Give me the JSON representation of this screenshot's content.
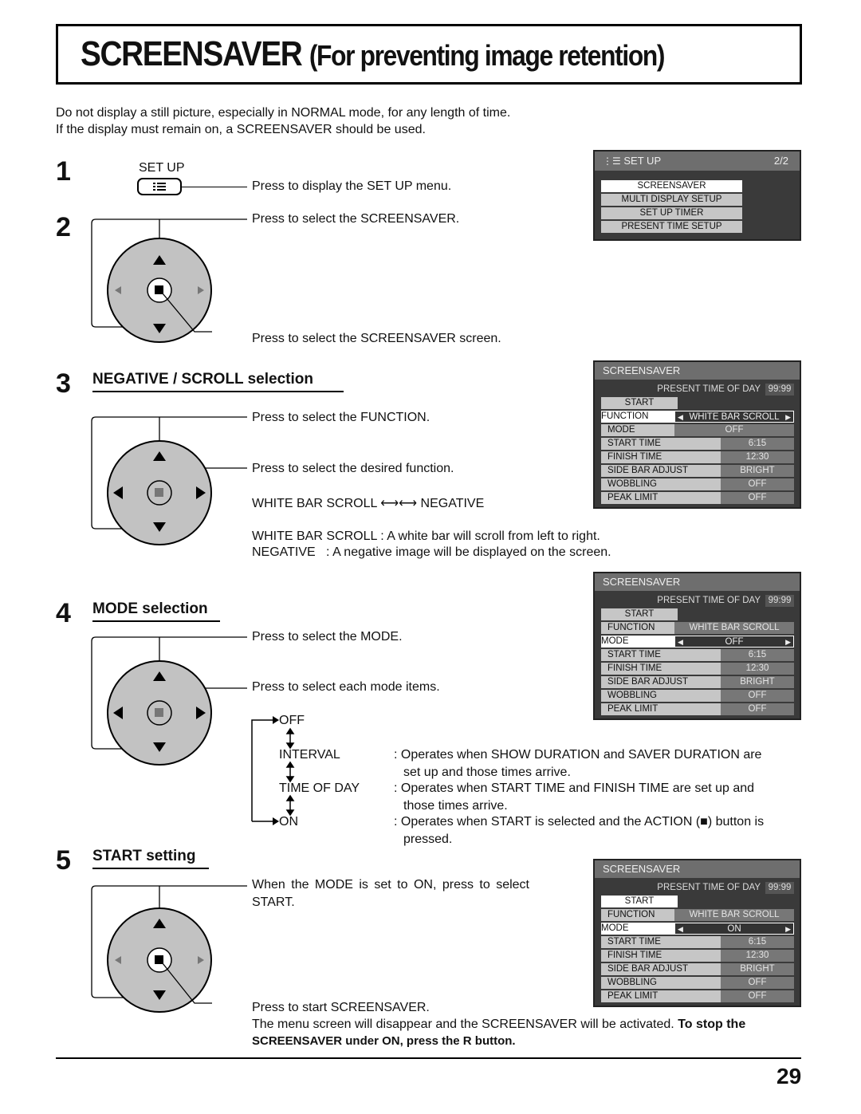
{
  "page": {
    "title_main": "SCREENSAVER",
    "title_sub": "(For preventing image retention)",
    "intro_line1": "Do not display a still picture, especially in NORMAL mode, for any length of time.",
    "intro_line2": "If the display must remain on, a SCREENSAVER should be used.",
    "page_number": "29"
  },
  "steps": {
    "s1": {
      "number": "1",
      "button_label": "SET UP",
      "text": "Press to display the SET UP menu."
    },
    "s2": {
      "number": "2",
      "text_up": "Press to select the SCREENSAVER.",
      "text_action": "Press to select the SCREENSAVER screen."
    },
    "s3": {
      "number": "3",
      "heading": "NEGATIVE / SCROLL selection",
      "text_updown": "Press to select the FUNCTION.",
      "text_leftright": "Press to select the desired function.",
      "toggle_left": "WHITE BAR SCROLL",
      "toggle_right": "NEGATIVE",
      "desc1": "WHITE BAR SCROLL : A white bar will scroll from left to right.",
      "desc2": "NEGATIVE   : A negative image will be displayed on the screen."
    },
    "s4": {
      "number": "4",
      "heading": "MODE selection",
      "text_updown": "Press to select the MODE.",
      "text_leftright": "Press to select each mode items.",
      "modes": [
        {
          "name": "OFF",
          "desc": ""
        },
        {
          "name": "INTERVAL",
          "desc": ": Operates when SHOW DURATION and SAVER DURATION are",
          "desc2": "set up and those times arrive."
        },
        {
          "name": "TIME OF DAY",
          "desc": ": Operates when START TIME and FINISH TIME are set up and",
          "desc2": "those times arrive."
        },
        {
          "name": "ON",
          "desc": ": Operates when START is selected and the ACTION (■) button is",
          "desc2": "pressed."
        }
      ]
    },
    "s5": {
      "number": "5",
      "heading": "START setting",
      "text_updown_1": "When the MODE is set to ON, press to select",
      "text_updown_2": "START.",
      "text_action": "Press to start SCREENSAVER.",
      "final_1": "The menu screen will disappear and the SCREENSAVER will be activated.",
      "final_1_bold": "To stop the",
      "final_2_bold": "SCREENSAVER under ON, press the R button."
    }
  },
  "osd_setup": {
    "title": "SET UP",
    "page": "2/2",
    "items": [
      "SCREENSAVER",
      "MULTI DISPLAY SETUP",
      "SET UP TIMER",
      "PRESENT TIME SETUP"
    ],
    "selected_index": 0
  },
  "osd_screens": [
    {
      "title": "SCREENSAVER",
      "present_label": "PRESENT  TIME OF DAY",
      "present_value": "99:99",
      "start": "START",
      "selected": "FUNCTION",
      "function_label": "FUNCTION",
      "function_value": "WHITE BAR SCROLL",
      "mode_label": "MODE",
      "mode_value": "OFF",
      "rows": [
        {
          "label": "START TIME",
          "value": "6:15"
        },
        {
          "label": "FINISH TIME",
          "value": "12:30"
        },
        {
          "label": "SIDE BAR ADJUST",
          "value": "BRIGHT"
        },
        {
          "label": "WOBBLING",
          "value": "OFF"
        },
        {
          "label": "PEAK LIMIT",
          "value": "OFF"
        }
      ]
    },
    {
      "title": "SCREENSAVER",
      "present_label": "PRESENT  TIME OF DAY",
      "present_value": "99:99",
      "start": "START",
      "selected": "MODE",
      "function_label": "FUNCTION",
      "function_value": "WHITE BAR SCROLL",
      "mode_label": "MODE",
      "mode_value": "OFF",
      "rows": [
        {
          "label": "START TIME",
          "value": "6:15"
        },
        {
          "label": "FINISH TIME",
          "value": "12:30"
        },
        {
          "label": "SIDE BAR ADJUST",
          "value": "BRIGHT"
        },
        {
          "label": "WOBBLING",
          "value": "OFF"
        },
        {
          "label": "PEAK LIMIT",
          "value": "OFF"
        }
      ]
    },
    {
      "title": "SCREENSAVER",
      "present_label": "PRESENT  TIME OF DAY",
      "present_value": "99:99",
      "start": "START",
      "selected": "MODE",
      "function_label": "FUNCTION",
      "function_value": "WHITE BAR SCROLL",
      "mode_label": "MODE",
      "mode_value": "ON",
      "rows": [
        {
          "label": "START TIME",
          "value": "6:15"
        },
        {
          "label": "FINISH TIME",
          "value": "12:30"
        },
        {
          "label": "SIDE BAR ADJUST",
          "value": "BRIGHT"
        },
        {
          "label": "WOBBLING",
          "value": "OFF"
        },
        {
          "label": "PEAK LIMIT",
          "value": "OFF"
        }
      ]
    }
  ],
  "colors": {
    "osd_bg": "#3a3a3a",
    "osd_header": "#6e6e6e",
    "osd_label": "#c6c6c6",
    "osd_value": "#777777",
    "pad": "#c2c2c2"
  }
}
